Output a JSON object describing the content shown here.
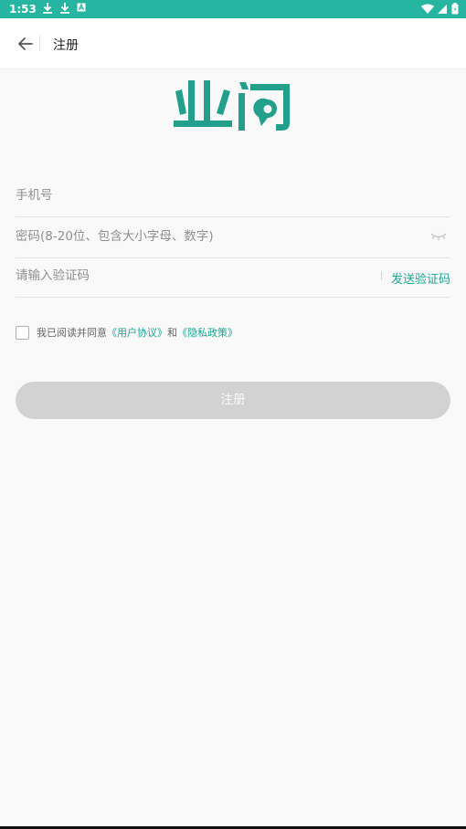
{
  "status_bar": {
    "time": "1:53",
    "icons": [
      "download-icon",
      "download-icon",
      "a-box-icon",
      "wifi-icon",
      "signal-icon",
      "battery-icon"
    ],
    "color": "#26b5a0"
  },
  "header": {
    "title": "注册"
  },
  "logo": {
    "text": "业问",
    "color": "#23a08c"
  },
  "form": {
    "phone_placeholder": "手机号",
    "password_placeholder": "密码(8-20位、包含大小字母、数字)",
    "code_placeholder": "请输入验证码",
    "send_code_label": "发送验证码"
  },
  "agreement": {
    "prefix": "我已阅读并同意",
    "user_agreement": "《用户协议》",
    "and": "和",
    "privacy_policy": "《隐私政策》"
  },
  "register_button": {
    "label": "注册"
  },
  "colors": {
    "accent": "#1ba596",
    "button_disabled": "#d2d2d2",
    "background": "#f9f9f9"
  }
}
